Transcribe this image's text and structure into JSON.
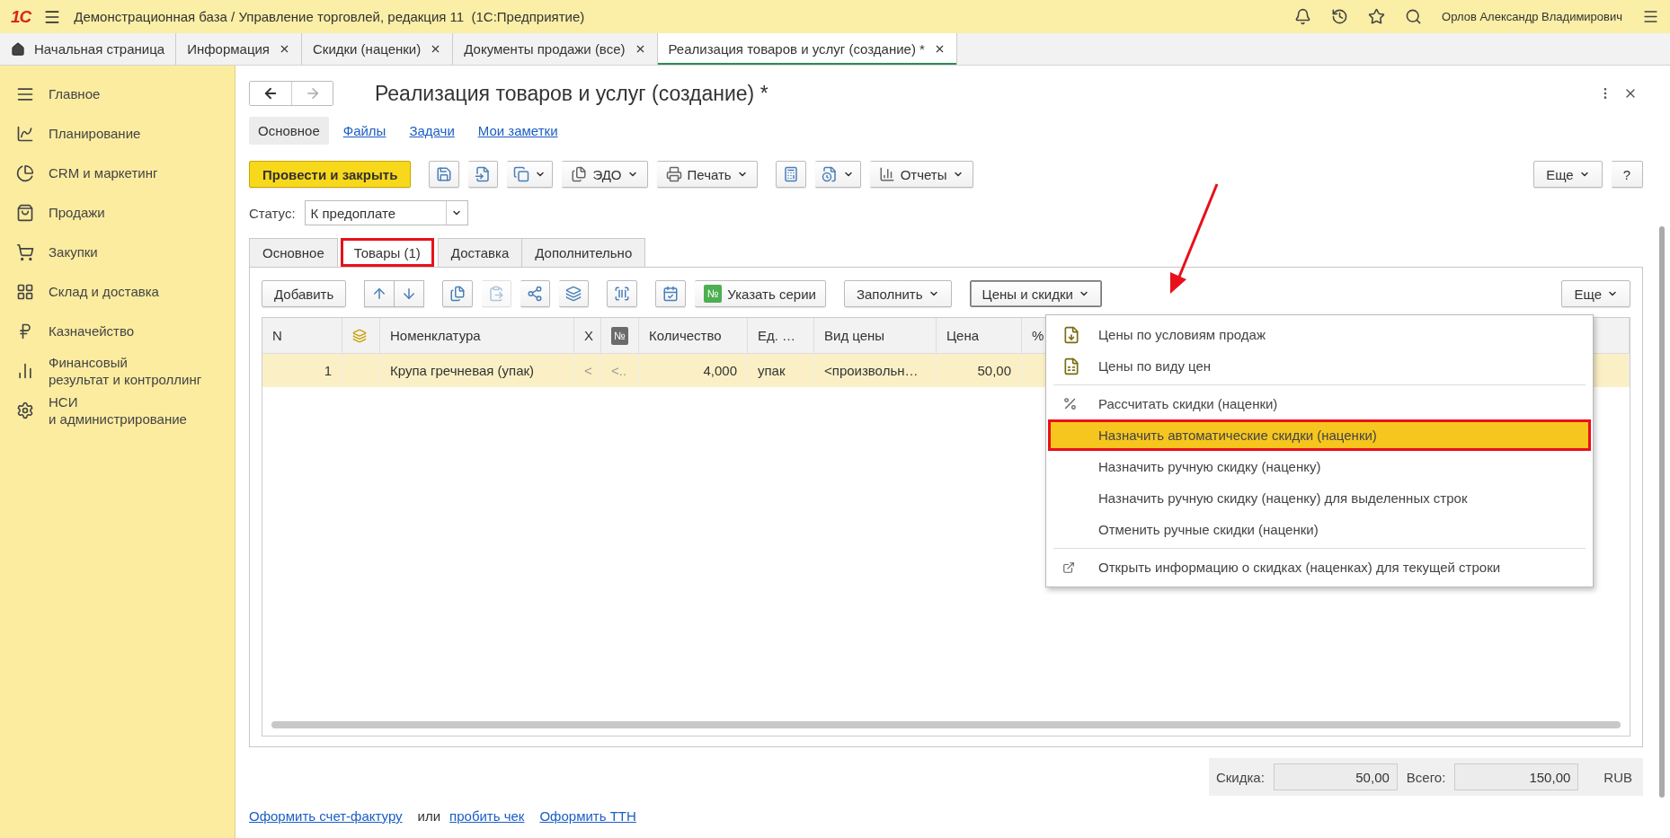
{
  "header": {
    "logo": "1С",
    "title": "Демонстрационная база / Управление торговлей, редакция 11  (1С:Предприятие)",
    "user": "Орлов Александр Владимирович"
  },
  "open_tabs": [
    {
      "label": "Начальная страница",
      "kind": "home",
      "selected": false
    },
    {
      "label": "Информация",
      "kind": "closable",
      "selected": false
    },
    {
      "label": "Скидки (наценки)",
      "kind": "closable",
      "selected": false
    },
    {
      "label": "Документы продажи (все)",
      "kind": "closable",
      "selected": false
    },
    {
      "label": "Реализация товаров и услуг (создание) *",
      "kind": "closable",
      "selected": true
    }
  ],
  "sidebar": {
    "items": [
      {
        "label": "Главное"
      },
      {
        "label": "Планирование"
      },
      {
        "label": "CRM и маркетинг"
      },
      {
        "label": "Продажи"
      },
      {
        "label": "Закупки"
      },
      {
        "label": "Склад и доставка"
      },
      {
        "label": "Казначейство"
      },
      {
        "label": "Финансовый\nрезультат и контроллинг"
      },
      {
        "label": "НСИ\nи администрирование"
      }
    ]
  },
  "document": {
    "title": "Реализация товаров и услуг (создание) *",
    "sections": [
      {
        "label": "Основное",
        "selected": true
      },
      {
        "label": "Файлы",
        "selected": false
      },
      {
        "label": "Задачи",
        "selected": false
      },
      {
        "label": "Мои заметки",
        "selected": false
      }
    ],
    "toolbar": {
      "groups": [
        [
          {
            "kind": "primary",
            "label": "Провести и закрыть",
            "dropdown": false
          }
        ],
        [
          {
            "kind": "icon",
            "dropdown": false
          },
          {
            "kind": "icon",
            "dropdown": false
          },
          {
            "kind": "icon",
            "dropdown": true
          },
          {
            "kind": "text",
            "label": "ЭДО",
            "dropdown": true
          },
          {
            "kind": "text",
            "label": "Печать",
            "dropdown": true
          }
        ],
        [
          {
            "kind": "icon",
            "dropdown": false
          },
          {
            "kind": "icon",
            "dropdown": true
          },
          {
            "kind": "text",
            "label": "Отчеты",
            "dropdown": true
          }
        ]
      ],
      "right": [
        {
          "kind": "plain",
          "label": "Еще",
          "dropdown": true
        },
        {
          "kind": "plain",
          "label": "?",
          "dropdown": false
        }
      ]
    },
    "status": {
      "label": "Статус:",
      "value": "К предоплате"
    },
    "tabs": [
      {
        "label": "Основное",
        "selected": false,
        "marked": false
      },
      {
        "label": "Товары (1)",
        "selected": true,
        "marked": true
      },
      {
        "label": "Доставка",
        "selected": false,
        "marked": false
      },
      {
        "label": "Дополнительно",
        "selected": false,
        "marked": false
      }
    ],
    "goods_toolbar": {
      "groups": [
        {
          "joined": false,
          "items": [
            {
              "kind": "plain",
              "label": "Добавить",
              "dropdown": false,
              "disabled": false,
              "open": false
            }
          ]
        },
        {
          "joined": true,
          "items": [
            {
              "kind": "icon",
              "dropdown": false,
              "disabled": false,
              "open": false
            },
            {
              "kind": "icon",
              "dropdown": false,
              "disabled": false,
              "open": false
            }
          ]
        },
        {
          "joined": false,
          "items": [
            {
              "kind": "icon",
              "dropdown": false,
              "disabled": false,
              "open": false
            },
            {
              "kind": "icon",
              "dropdown": false,
              "disabled": true,
              "open": false
            },
            {
              "kind": "icon",
              "dropdown": false,
              "disabled": false,
              "open": false
            },
            {
              "kind": "icon",
              "dropdown": false,
              "disabled": false,
              "open": false
            }
          ]
        },
        {
          "joined": false,
          "items": [
            {
              "kind": "icon",
              "dropdown": false,
              "disabled": false,
              "open": false
            }
          ]
        },
        {
          "joined": false,
          "items": [
            {
              "kind": "icon",
              "dropdown": false,
              "disabled": false,
              "open": false
            },
            {
              "kind": "badge",
              "badge": "№",
              "label": "Указать серии",
              "dropdown": false,
              "disabled": false,
              "open": false
            }
          ]
        },
        {
          "joined": false,
          "items": [
            {
              "kind": "plain",
              "label": "Заполнить",
              "dropdown": true,
              "disabled": false,
              "open": false
            }
          ]
        },
        {
          "joined": false,
          "items": [
            {
              "kind": "plain",
              "label": "Цены и скидки",
              "dropdown": true,
              "disabled": false,
              "open": true
            }
          ]
        }
      ],
      "right": [
        {
          "kind": "plain",
          "label": "Еще",
          "dropdown": true,
          "disabled": false,
          "open": false
        }
      ]
    },
    "table": {
      "columns": [
        {
          "kind": "text",
          "label": "N"
        },
        {
          "kind": "icon"
        },
        {
          "kind": "text",
          "label": "Номенклатура"
        },
        {
          "kind": "text",
          "label": "X"
        },
        {
          "kind": "badge",
          "label": "№"
        },
        {
          "kind": "text",
          "label": "Количество"
        },
        {
          "kind": "text",
          "label": "Ед. …"
        },
        {
          "kind": "text",
          "label": "Вид цены"
        },
        {
          "kind": "text",
          "label": "Цена"
        },
        {
          "kind": "text",
          "label": "%"
        }
      ],
      "rows": [
        {
          "selected": true,
          "cells": [
            "1",
            "",
            "Крупа гречневая (упак)",
            "<",
            "<..",
            "4,000",
            "упак",
            "<произвольн…",
            "50,00",
            ""
          ]
        }
      ]
    },
    "totals": [
      {
        "label": "Скидка:",
        "value": "50,00"
      },
      {
        "label": "Всего:",
        "value": "150,00"
      }
    ],
    "currency": "RUB",
    "footer_links": [
      {
        "kind": "link",
        "text": "Оформить счет-фактуру"
      },
      {
        "kind": "text",
        "text": "или"
      },
      {
        "kind": "link",
        "text": "пробить чек"
      },
      {
        "kind": "link",
        "text": "Оформить ТТН"
      }
    ]
  },
  "price_menu": {
    "groups": [
      {
        "items": [
          {
            "kind": "price-doc",
            "label": "Цены по условиям продаж",
            "selected": false,
            "marked": false
          },
          {
            "kind": "price-table",
            "label": "Цены по виду цен",
            "selected": false,
            "marked": false
          }
        ]
      },
      {
        "items": [
          {
            "kind": "percent",
            "label": "Рассчитать скидки (наценки)",
            "selected": false,
            "marked": false
          },
          {
            "kind": "plain",
            "label": "Назначить автоматические скидки (наценки)",
            "selected": true,
            "marked": true
          },
          {
            "kind": "plain",
            "label": "Назначить ручную скидку (наценку)",
            "selected": false,
            "marked": false
          },
          {
            "kind": "plain",
            "label": "Назначить ручную скидку (наценку) для выделенных строк",
            "selected": false,
            "marked": false
          },
          {
            "kind": "plain",
            "label": "Отменить ручные скидки (наценки)",
            "selected": false,
            "marked": false
          }
        ]
      },
      {
        "items": [
          {
            "kind": "open",
            "label": "Открыть информацию о скидках (наценках) для текущей строки",
            "selected": false,
            "marked": false
          }
        ]
      }
    ]
  }
}
